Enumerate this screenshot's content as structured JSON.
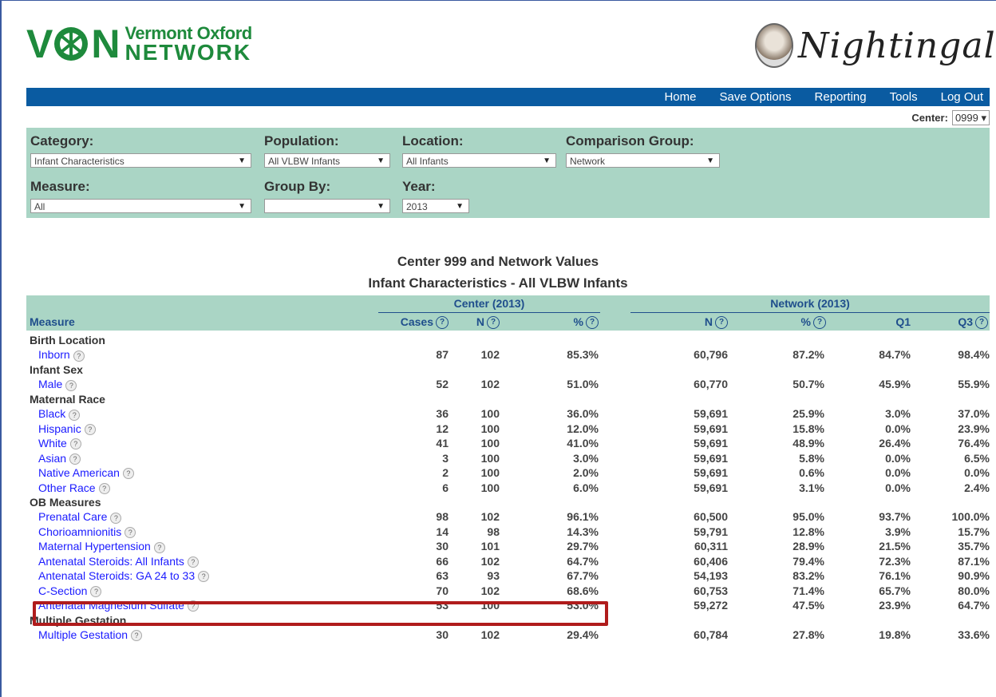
{
  "logo": {
    "mark": "VON",
    "line1": "Vermont Oxford",
    "line2": "NETWORK"
  },
  "nightingale": {
    "script": "Nightingale"
  },
  "nav": {
    "items": [
      "Home",
      "Save Options",
      "Reporting",
      "Tools",
      "Log Out"
    ]
  },
  "center": {
    "label": "Center:",
    "value": "0999 ▾"
  },
  "filters": {
    "category": {
      "label": "Category:",
      "value": "Infant Characteristics"
    },
    "population": {
      "label": "Population:",
      "value": "All VLBW Infants"
    },
    "location": {
      "label": "Location:",
      "value": "All Infants"
    },
    "comparison": {
      "label": "Comparison Group:",
      "value": "Network"
    },
    "measure": {
      "label": "Measure:",
      "value": "All"
    },
    "groupby": {
      "label": "Group By:",
      "value": ""
    },
    "year": {
      "label": "Year:",
      "value": "2013"
    }
  },
  "title": {
    "line1": "Center 999 and Network Values",
    "line2": "Infant Characteristics - All VLBW Infants"
  },
  "table": {
    "group_center": "Center (2013)",
    "group_network": "Network  (2013)",
    "col_measure": "Measure",
    "col_cases": "Cases",
    "col_n": "N",
    "col_pct": "%",
    "col_net_n": "N",
    "col_net_pct": "%",
    "col_q1": "Q1",
    "col_q3": "Q3",
    "rows": [
      {
        "type": "cat",
        "label": "Birth Location"
      },
      {
        "type": "m",
        "label": "Inborn",
        "cases": "87",
        "n": "102",
        "pct": "85.3%",
        "nn": "60,796",
        "np": "87.2%",
        "q1": "84.7%",
        "q3": "98.4%"
      },
      {
        "type": "cat",
        "label": "Infant Sex"
      },
      {
        "type": "m",
        "label": "Male",
        "cases": "52",
        "n": "102",
        "pct": "51.0%",
        "nn": "60,770",
        "np": "50.7%",
        "q1": "45.9%",
        "q3": "55.9%"
      },
      {
        "type": "cat",
        "label": "Maternal Race"
      },
      {
        "type": "m",
        "label": "Black",
        "cases": "36",
        "n": "100",
        "pct": "36.0%",
        "nn": "59,691",
        "np": "25.9%",
        "q1": "3.0%",
        "q3": "37.0%"
      },
      {
        "type": "m",
        "label": "Hispanic",
        "cases": "12",
        "n": "100",
        "pct": "12.0%",
        "nn": "59,691",
        "np": "15.8%",
        "q1": "0.0%",
        "q3": "23.9%"
      },
      {
        "type": "m",
        "label": "White",
        "cases": "41",
        "n": "100",
        "pct": "41.0%",
        "nn": "59,691",
        "np": "48.9%",
        "q1": "26.4%",
        "q3": "76.4%"
      },
      {
        "type": "m",
        "label": "Asian",
        "cases": "3",
        "n": "100",
        "pct": "3.0%",
        "nn": "59,691",
        "np": "5.8%",
        "q1": "0.0%",
        "q3": "6.5%"
      },
      {
        "type": "m",
        "label": "Native American",
        "cases": "2",
        "n": "100",
        "pct": "2.0%",
        "nn": "59,691",
        "np": "0.6%",
        "q1": "0.0%",
        "q3": "0.0%"
      },
      {
        "type": "m",
        "label": "Other Race",
        "cases": "6",
        "n": "100",
        "pct": "6.0%",
        "nn": "59,691",
        "np": "3.1%",
        "q1": "0.0%",
        "q3": "2.4%"
      },
      {
        "type": "cat",
        "label": "OB Measures"
      },
      {
        "type": "m",
        "label": "Prenatal Care",
        "cases": "98",
        "n": "102",
        "pct": "96.1%",
        "nn": "60,500",
        "np": "95.0%",
        "q1": "93.7%",
        "q3": "100.0%"
      },
      {
        "type": "m",
        "label": "Chorioamnionitis",
        "cases": "14",
        "n": "98",
        "pct": "14.3%",
        "nn": "59,791",
        "np": "12.8%",
        "q1": "3.9%",
        "q3": "15.7%"
      },
      {
        "type": "m",
        "label": "Maternal Hypertension",
        "cases": "30",
        "n": "101",
        "pct": "29.7%",
        "nn": "60,311",
        "np": "28.9%",
        "q1": "21.5%",
        "q3": "35.7%"
      },
      {
        "type": "m",
        "label": "Antenatal Steroids: All Infants",
        "cases": "66",
        "n": "102",
        "pct": "64.7%",
        "nn": "60,406",
        "np": "79.4%",
        "q1": "72.3%",
        "q3": "87.1%"
      },
      {
        "type": "m",
        "label": "Antenatal Steroids: GA 24 to 33",
        "cases": "63",
        "n": "93",
        "pct": "67.7%",
        "nn": "54,193",
        "np": "83.2%",
        "q1": "76.1%",
        "q3": "90.9%"
      },
      {
        "type": "m",
        "label": "C-Section",
        "cases": "70",
        "n": "102",
        "pct": "68.6%",
        "nn": "60,753",
        "np": "71.4%",
        "q1": "65.7%",
        "q3": "80.0%"
      },
      {
        "type": "m",
        "label": "Antenatal Magnesium Sulfate",
        "cases": "53",
        "n": "100",
        "pct": "53.0%",
        "nn": "59,272",
        "np": "47.5%",
        "q1": "23.9%",
        "q3": "64.7%"
      },
      {
        "type": "cat",
        "label": "Multiple Gestation"
      },
      {
        "type": "m",
        "label": "Multiple Gestation",
        "cases": "30",
        "n": "102",
        "pct": "29.4%",
        "nn": "60,784",
        "np": "27.8%",
        "q1": "19.8%",
        "q3": "33.6%"
      }
    ]
  },
  "colors": {
    "nav": "#0a5ba1",
    "panel": "#aad5c5",
    "brand": "#1e8a3c",
    "link": "#1a1aff",
    "highlight": "#b01c1c"
  }
}
